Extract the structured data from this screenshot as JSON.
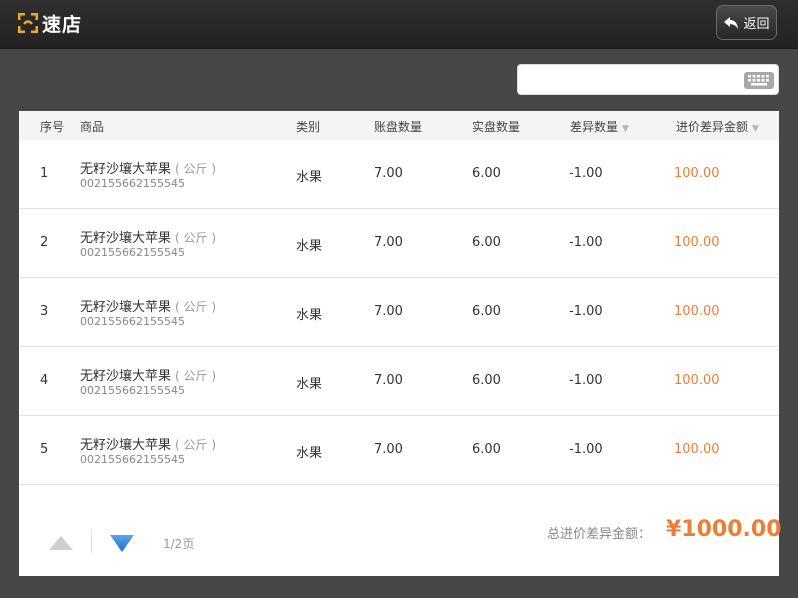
{
  "app": {
    "logo_text": "速店"
  },
  "header": {
    "back_label": "返回"
  },
  "search": {
    "value": "",
    "placeholder": ""
  },
  "table": {
    "headers": {
      "index": "序号",
      "product": "商品",
      "category": "类别",
      "book_qty": "账盘数量",
      "actual_qty": "实盘数量",
      "diff_qty": "差异数量",
      "diff_amount": "进价差异金额"
    },
    "sort_indicator": "▼",
    "rows": [
      {
        "index": "1",
        "name": "无籽沙壤大苹果",
        "unit": "( 公斤 )",
        "code": "002155662155545",
        "category": "水果",
        "book_qty": "7.00",
        "actual_qty": "6.00",
        "diff_qty": "-1.00",
        "diff_amount": "100.00"
      },
      {
        "index": "2",
        "name": "无籽沙壤大苹果",
        "unit": "( 公斤 )",
        "code": "002155662155545",
        "category": "水果",
        "book_qty": "7.00",
        "actual_qty": "6.00",
        "diff_qty": "-1.00",
        "diff_amount": "100.00"
      },
      {
        "index": "3",
        "name": "无籽沙壤大苹果",
        "unit": "( 公斤 )",
        "code": "002155662155545",
        "category": "水果",
        "book_qty": "7.00",
        "actual_qty": "6.00",
        "diff_qty": "-1.00",
        "diff_amount": "100.00"
      },
      {
        "index": "4",
        "name": "无籽沙壤大苹果",
        "unit": "( 公斤 )",
        "code": "002155662155545",
        "category": "水果",
        "book_qty": "7.00",
        "actual_qty": "6.00",
        "diff_qty": "-1.00",
        "diff_amount": "100.00"
      },
      {
        "index": "5",
        "name": "无籽沙壤大苹果",
        "unit": "( 公斤 )",
        "code": "002155662155545",
        "category": "水果",
        "book_qty": "7.00",
        "actual_qty": "6.00",
        "diff_qty": "-1.00",
        "diff_amount": "100.00"
      }
    ]
  },
  "footer": {
    "page_info": "1/2页",
    "total_label": "总进价差异金额：",
    "total_value": "¥1000.00"
  },
  "colors": {
    "accent": "#ec7e36",
    "logo": "#f5a623",
    "pager_active": "#2f7fd8",
    "pager_inactive": "#cfcfcf"
  },
  "icons": {
    "logo": "store-logo-icon",
    "back": "back-arrow-icon",
    "keyboard": "keyboard-icon",
    "up": "page-up-icon",
    "down": "page-down-icon"
  }
}
